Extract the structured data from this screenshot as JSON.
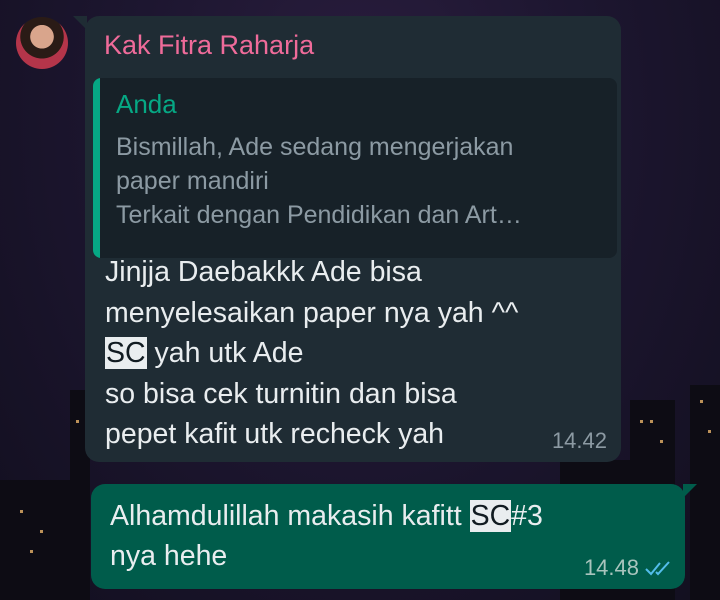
{
  "incoming": {
    "sender": "Kak Fitra Raharja",
    "quote": {
      "author": "Anda",
      "lines": [
        "Bismillah, Ade sedang mengerjakan",
        "paper mandiri",
        "Terkait dengan Pendidikan dan Art…"
      ]
    },
    "text": {
      "line1": "Jinjja Daebakkk Ade bisa",
      "line2": "menyelesaikan paper nya yah ^^",
      "line3_highlight": "SC",
      "line3_rest": " yah utk Ade",
      "line4": "so bisa cek turnitin dan bisa",
      "line5": "pepet kafit utk recheck yah"
    },
    "time": "14.42"
  },
  "outgoing": {
    "text": {
      "line1_before": "Alhamdulillah makasih kafitt ",
      "line1_highlight": "SC",
      "line1_after": "#3",
      "line2": "nya hehe"
    },
    "time": "14.48",
    "status_icon": "double-check-icon"
  },
  "colors": {
    "sender_name": "#ef6b9a",
    "quote_accent": "#06a884",
    "incoming_bubble": "#1f2c34",
    "outgoing_bubble": "#005c4b",
    "read_ticks": "#53bdeb"
  }
}
